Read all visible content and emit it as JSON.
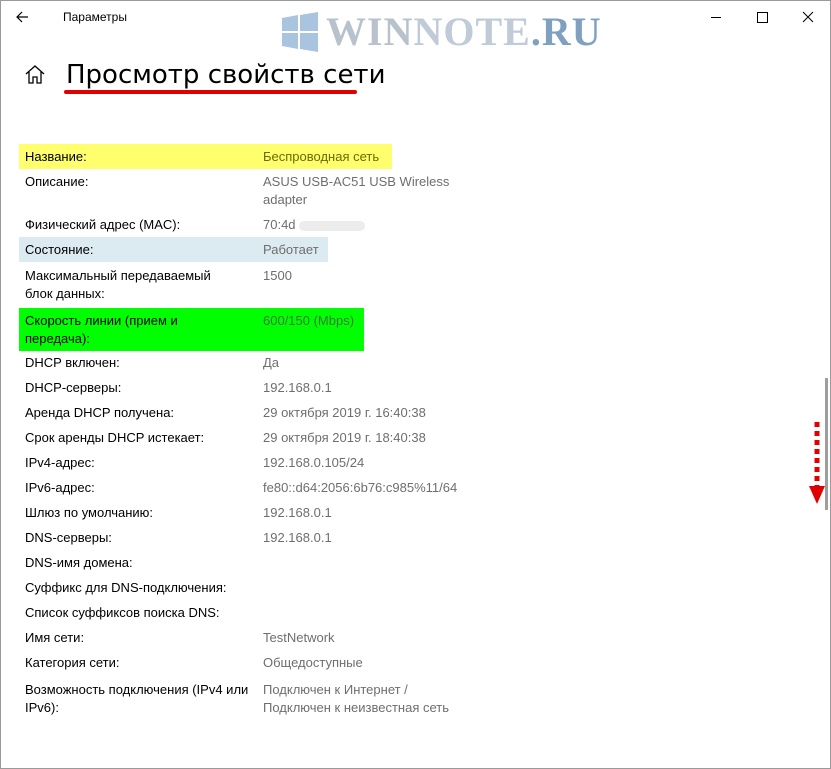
{
  "window": {
    "app_title": "Параметры",
    "page_title": "Просмотр свойств сети"
  },
  "watermark": {
    "win": "WIN",
    "note": "NOTE",
    "ru": ".RU"
  },
  "properties": [
    {
      "label": "Название:",
      "value": "Беспроводная сеть"
    },
    {
      "label": "Описание:",
      "value": "ASUS USB-AC51 USB Wireless adapter"
    },
    {
      "label": "Физический адрес (MAC):",
      "value": "70:4d"
    },
    {
      "label": "Состояние:",
      "value": "Работает"
    },
    {
      "label": "Максимальный передаваемый блок данных:",
      "value": "1500"
    },
    {
      "label": "Скорость линии (прием и передача):",
      "value": "600/150 (Mbps)"
    },
    {
      "label": "DHCP включен:",
      "value": "Да"
    },
    {
      "label": "DHCP-серверы:",
      "value": "192.168.0.1"
    },
    {
      "label": "Аренда DHCP получена:",
      "value": "29 октября 2019 г. 16:40:38"
    },
    {
      "label": "Срок аренды DHCP истекает:",
      "value": "29 октября 2019 г. 18:40:38"
    },
    {
      "label": "IPv4-адрес:",
      "value": "192.168.0.105/24"
    },
    {
      "label": "IPv6-адрес:",
      "value": "fe80::d64:2056:6b76:c985%11/64"
    },
    {
      "label": "Шлюз по умолчанию:",
      "value": "192.168.0.1"
    },
    {
      "label": "DNS-серверы:",
      "value": "192.168.0.1"
    },
    {
      "label": "DNS-имя домена:",
      "value": ""
    },
    {
      "label": "Суффикс для DNS-подключения:",
      "value": ""
    },
    {
      "label": "Список суффиксов поиска DNS:",
      "value": ""
    },
    {
      "label": "Имя сети:",
      "value": "TestNetwork"
    },
    {
      "label": "Категория сети:",
      "value": "Общедоступные"
    },
    {
      "label": "Возможность подключения (IPv4 или IPv6):",
      "value": "Подключен к Интернет / Подключен к неизвестная сеть"
    }
  ],
  "colors": {
    "highlight_yellow": "#ffff6e",
    "highlight_blue": "#dceaf1",
    "highlight_green": "#00ff00",
    "annotation_red": "#e00000"
  }
}
